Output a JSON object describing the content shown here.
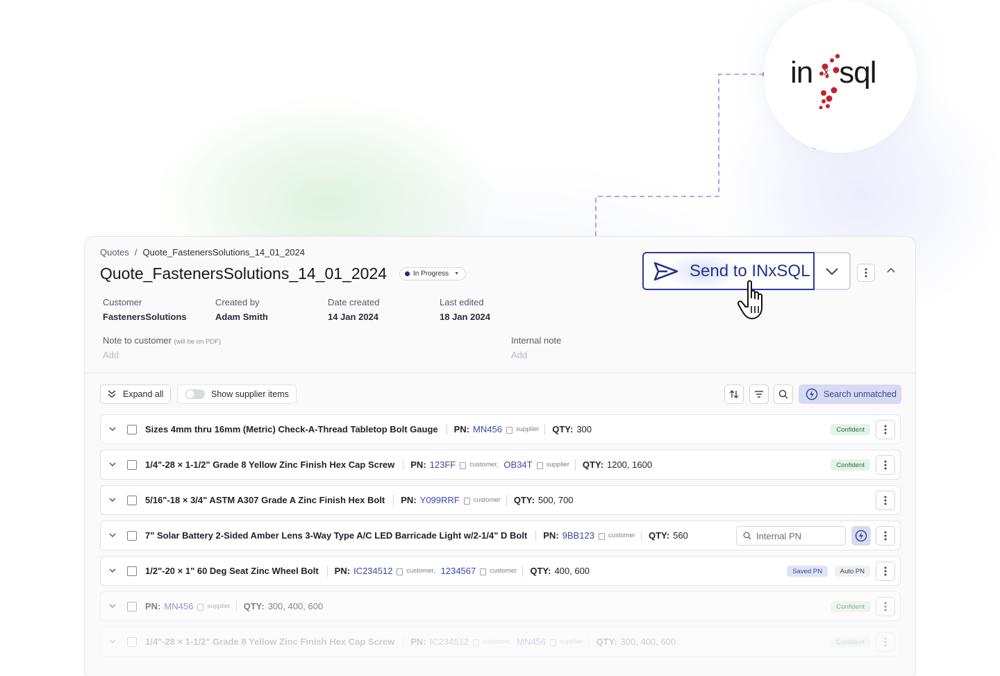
{
  "brand": {
    "logo_left": "in",
    "logo_x": "x",
    "logo_right": "sql",
    "accent": "#2c3a9c",
    "logo_red": "#c8202a"
  },
  "breadcrumb": {
    "root": "Quotes",
    "separator": "/",
    "current": "Quote_FastenersSolutions_14_01_2024"
  },
  "quote": {
    "title": "Quote_FastenersSolutions_14_01_2024",
    "status": "In Progress",
    "meta": [
      {
        "label": "Customer",
        "value": "FastenersSolutions"
      },
      {
        "label": "Created by",
        "value": "Adam Smith"
      },
      {
        "label": "Date created",
        "value": "14 Jan 2024"
      },
      {
        "label": "Last edited",
        "value": "18 Jan 2024"
      }
    ],
    "note_customer": {
      "label": "Note to customer",
      "hint": "(will be on PDF)",
      "placeholder": "Add"
    },
    "internal_note": {
      "label": "Internal note",
      "placeholder": "Add"
    }
  },
  "actions": {
    "send_label": "Send to INxSQL"
  },
  "toolbar": {
    "expand_all": "Expand all",
    "show_supplier": "Show supplier items",
    "search_unmatched": "Search unmatched"
  },
  "labels": {
    "pn": "PN:",
    "qty": "QTY:"
  },
  "items": [
    {
      "name": "Sizes 4mm thru 16mm (Metric) Check-A-Thread Tabletop Bolt Gauge",
      "pns": [
        {
          "code": "MN456",
          "source": "supplier"
        }
      ],
      "qty": "300",
      "badges": [
        "Confident"
      ]
    },
    {
      "name": "1/4\"-28 × 1-1/2\" Grade 8 Yellow Zinc Finish Hex Cap Screw",
      "pns": [
        {
          "code": "123FF",
          "source": "customer,"
        },
        {
          "code": "OB34T",
          "source": "supplier"
        }
      ],
      "qty": "1200, 1600",
      "badges": [
        "Confident"
      ]
    },
    {
      "name": "5/16\"-18 × 3/4\" ASTM A307 Grade A Zinc Finish Hex Bolt",
      "pns": [
        {
          "code": "Y099RRF",
          "source": "customer"
        }
      ],
      "qty": "500, 700",
      "badges": []
    },
    {
      "name": "7\" Solar Battery 2-Sided Amber Lens 3-Way Type A/C LED Barricade Light w/2-1/4\" D Bolt",
      "pns": [
        {
          "code": "9BB123",
          "source": "customer"
        }
      ],
      "qty": "560",
      "badges": [],
      "internal_pn_placeholder": "Internal PN"
    },
    {
      "name": "1/2\"-20 × 1\" 60 Deg Seat Zinc Wheel Bolt",
      "pns": [
        {
          "code": "IC234512",
          "source": "customer,"
        },
        {
          "code": "1234567",
          "source": "customer"
        }
      ],
      "qty": "400, 600",
      "badges": [
        "Saved PN",
        "Auto PN"
      ]
    },
    {
      "name": "",
      "pns": [
        {
          "code": "MN456",
          "source": "supplier"
        }
      ],
      "qty": "300, 400, 600",
      "badges": [
        "Confident"
      ]
    },
    {
      "name": "1/4\"-28 × 1-1/2\" Grade 8 Yellow Zinc Finish Hex Cap Screw",
      "pns": [
        {
          "code": "IC234512",
          "source": "customer,"
        },
        {
          "code": "MN456",
          "source": "supplier"
        }
      ],
      "qty": "300, 400, 600",
      "badges": [
        "Confident"
      ]
    }
  ]
}
